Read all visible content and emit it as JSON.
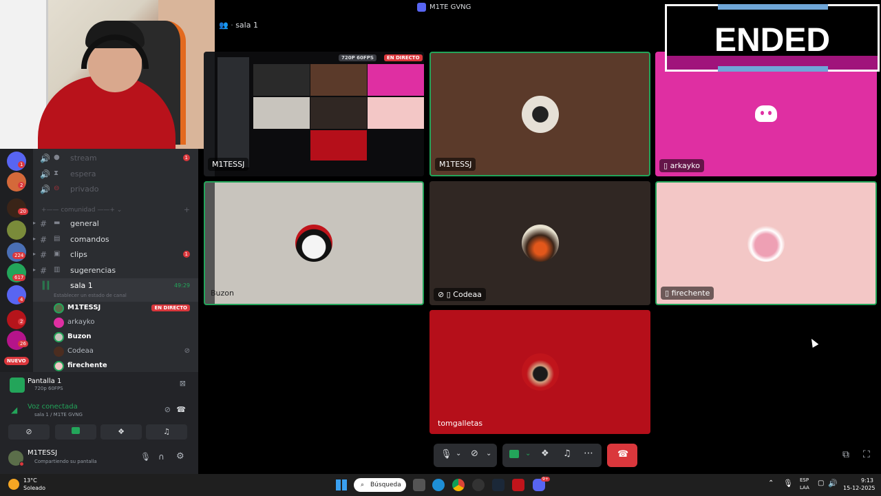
{
  "window_title": "M1TE GVNG",
  "room": {
    "name": "sala 1"
  },
  "ended_overlay": {
    "text": "ENDED"
  },
  "stream_preview": {
    "quality": "720P 60FPS",
    "live": "EN DIRECTO",
    "user": "M1TESSJ"
  },
  "tiles": [
    {
      "name": "M1TESSJ",
      "bg": "#5b3a2a"
    },
    {
      "name": "arkayko",
      "bg": "#df2fa2"
    },
    {
      "name": "Buzon",
      "bg": "#c8c4bd"
    },
    {
      "name": "Codeaa",
      "bg": "#302723"
    },
    {
      "name": "firechente",
      "bg": "#f3c7c6"
    },
    {
      "name": "tomgalletas",
      "bg": "#b50f1a"
    }
  ],
  "channels": {
    "voice_dim": [
      {
        "name": "stream",
        "badge": "1"
      },
      {
        "name": "espera",
        "badge": ""
      },
      {
        "name": "privado",
        "badge": ""
      }
    ],
    "category": "comunidad",
    "text_channels": [
      {
        "name": "general",
        "badge": ""
      },
      {
        "name": "comandos",
        "badge": ""
      },
      {
        "name": "clips",
        "badge": "1"
      },
      {
        "name": "sugerencias",
        "badge": ""
      }
    ],
    "voice_active": {
      "name": "sala 1",
      "timer": "49:29",
      "status_placeholder": "Establecer un estado de canal"
    },
    "voice_users": [
      {
        "name": "M1TESSJ",
        "live": "EN DIRECTO",
        "color": "#5b6e4a"
      },
      {
        "name": "arkayko",
        "live": "",
        "color": "#df2fa2"
      },
      {
        "name": "Buzon",
        "live": "",
        "color": "#c8c4bd"
      },
      {
        "name": "Codeaa",
        "live": "",
        "color": "#4b2d20"
      },
      {
        "name": "firechente",
        "live": "",
        "color": "#f3c7c6"
      }
    ]
  },
  "servers": {
    "badges": [
      "1",
      "2",
      "20",
      "224",
      "617",
      "4",
      "2",
      "26"
    ],
    "new_label": "NUEVO"
  },
  "panel": {
    "screen_title": "Pantalla 1",
    "screen_sub": "720p 60FPS",
    "voice_status": "Voz conectada",
    "voice_location": "sala 1 / M1TE GVNG",
    "user_name": "M1TESSJ",
    "user_status": "Compartiendo su pantalla"
  },
  "taskbar": {
    "weather_temp": "13°C",
    "weather_desc": "Soleado",
    "search_placeholder": "Búsqueda",
    "lang_1": "ESP",
    "lang_2": "LAA",
    "time": "9:13",
    "date": "15-12-2025",
    "discord_badge": "9+"
  },
  "colors": {
    "accent": "#23a55a",
    "danger": "#da373c",
    "blurple": "#5865f2"
  }
}
